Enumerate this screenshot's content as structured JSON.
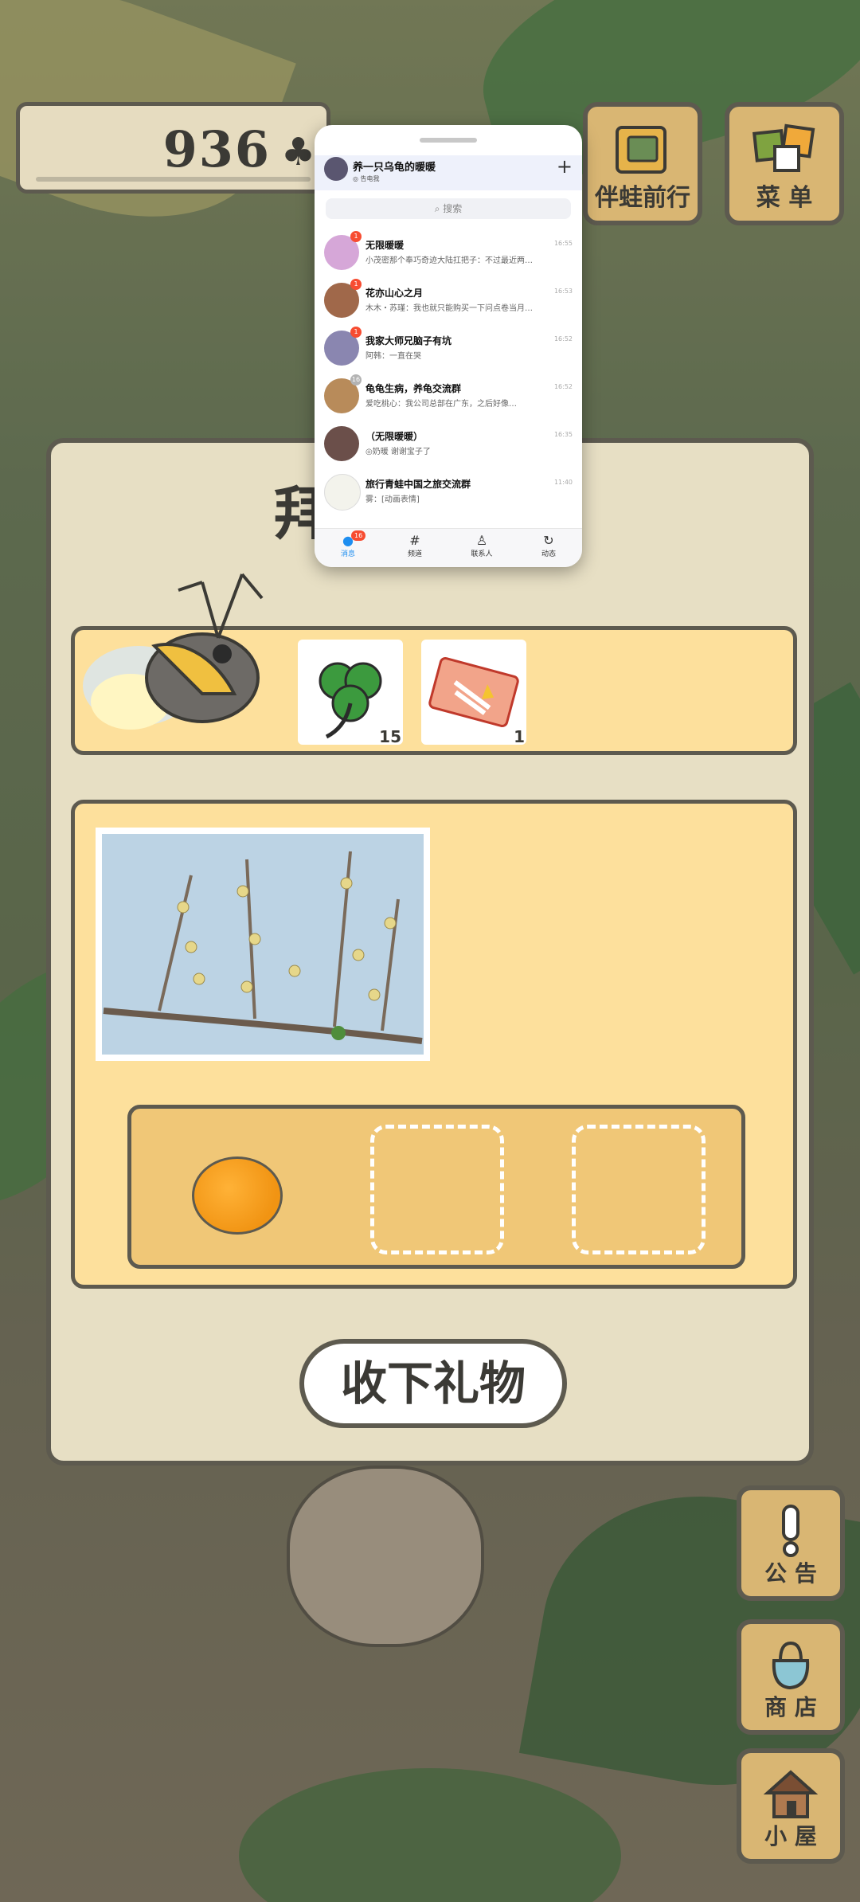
{
  "hud": {
    "clover_count": "936",
    "clover_icon": "clover-icon"
  },
  "top_buttons": [
    {
      "label": "伴蛙前行",
      "icon": "book-icon"
    },
    {
      "label": "菜 单",
      "icon": "menu-icon"
    }
  ],
  "dialog": {
    "title_partial": "拜",
    "items": [
      {
        "icon": "clover-icon",
        "count": "15"
      },
      {
        "icon": "ticket-icon",
        "count": "1"
      }
    ],
    "photo_icon": "photo-icon",
    "slot_item_icon": "orange-icon",
    "accept_label": "收下礼物"
  },
  "side_buttons": [
    {
      "label": "公 告",
      "icon": "exclamation-icon"
    },
    {
      "label": "商 店",
      "icon": "bag-icon"
    },
    {
      "label": "小 屋",
      "icon": "house-icon"
    }
  ],
  "chat": {
    "account_name": "养一只乌龟的暖暖",
    "account_status": "◎ 告电我",
    "search_placeholder": "搜索",
    "rows": [
      {
        "title": "无限暖暖 ",
        "preview": "小茂密那个奉巧奇迹大陆扛把子：不过最近两…",
        "time": "16:55",
        "badge": "1"
      },
      {
        "title": "花亦山心之月",
        "preview": "木木・苏瑾：我也就只能购买一下问点卷当月…",
        "time": "16:53",
        "badge": "1"
      },
      {
        "title": "我家大师兄脑子有坑",
        "preview": "阿韩：一直在哭",
        "time": "16:52",
        "badge": "1"
      },
      {
        "title": "龟龟生病，养龟交流群",
        "preview": "爱吃桃心：我公司总部在广东，之后好像…",
        "time": "16:52",
        "badge": "16"
      },
      {
        "title": "（无限暖暖）",
        "preview": "◎奶暖 谢谢宝子了",
        "time": "16:35",
        "badge": ""
      },
      {
        "title": "旅行青蛙中国之旅交流群",
        "preview": "雾：[动画表情]",
        "time": "11:40",
        "badge": ""
      }
    ],
    "tabs": [
      {
        "label": "消息",
        "icon": "chat-bubble-icon",
        "badge": "16"
      },
      {
        "label": "频道",
        "icon": "hashtag-icon"
      },
      {
        "label": "联系人",
        "icon": "person-icon"
      },
      {
        "label": "动态",
        "icon": "refresh-icon"
      }
    ]
  }
}
